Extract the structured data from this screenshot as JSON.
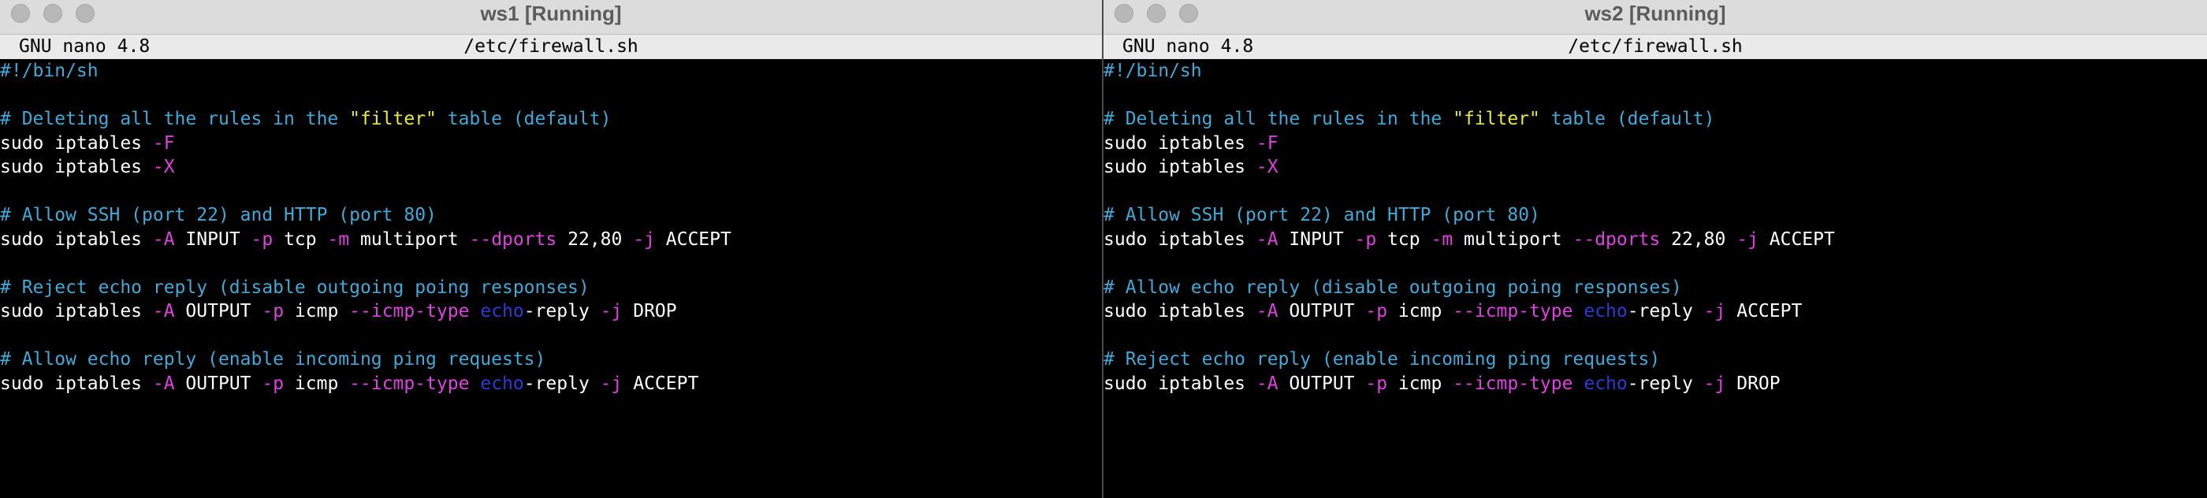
{
  "windows": [
    {
      "title": "ws1 [Running]",
      "nano_version": "GNU nano 4.8",
      "file_path": "/etc/firewall.sh",
      "lines": [
        [
          {
            "t": "#!/bin/sh",
            "c": "c"
          }
        ],
        [],
        [
          {
            "t": "# Deleting all the rules in the ",
            "c": "c"
          },
          {
            "t": "\"filter\"",
            "c": "s"
          },
          {
            "t": " table (default)",
            "c": "c"
          }
        ],
        [
          {
            "t": "sudo iptables ",
            "c": "t"
          },
          {
            "t": "-F",
            "c": "f"
          }
        ],
        [
          {
            "t": "sudo iptables ",
            "c": "t"
          },
          {
            "t": "-X",
            "c": "f"
          }
        ],
        [],
        [
          {
            "t": "# Allow SSH (port 22) and HTTP (port 80)",
            "c": "c"
          }
        ],
        [
          {
            "t": "sudo iptables ",
            "c": "t"
          },
          {
            "t": "-A",
            "c": "f"
          },
          {
            "t": " INPUT ",
            "c": "t"
          },
          {
            "t": "-p",
            "c": "f"
          },
          {
            "t": " tcp ",
            "c": "t"
          },
          {
            "t": "-m",
            "c": "f"
          },
          {
            "t": " multiport ",
            "c": "t"
          },
          {
            "t": "--dports",
            "c": "f"
          },
          {
            "t": " 22,80 ",
            "c": "t"
          },
          {
            "t": "-j",
            "c": "f"
          },
          {
            "t": " ACCEPT",
            "c": "t"
          }
        ],
        [],
        [
          {
            "t": "# Reject echo reply (disable outgoing poing responses)",
            "c": "c"
          }
        ],
        [
          {
            "t": "sudo iptables ",
            "c": "t"
          },
          {
            "t": "-A",
            "c": "f"
          },
          {
            "t": " OUTPUT ",
            "c": "t"
          },
          {
            "t": "-p",
            "c": "f"
          },
          {
            "t": " icmp ",
            "c": "t"
          },
          {
            "t": "--icmp-type",
            "c": "f"
          },
          {
            "t": " ",
            "c": "t"
          },
          {
            "t": "echo",
            "c": "k"
          },
          {
            "t": "-reply ",
            "c": "t"
          },
          {
            "t": "-j",
            "c": "f"
          },
          {
            "t": " DROP",
            "c": "t"
          }
        ],
        [],
        [
          {
            "t": "# Allow echo reply (enable incoming ping requests)",
            "c": "c"
          }
        ],
        [
          {
            "t": "sudo iptables ",
            "c": "t"
          },
          {
            "t": "-A",
            "c": "f"
          },
          {
            "t": " OUTPUT ",
            "c": "t"
          },
          {
            "t": "-p",
            "c": "f"
          },
          {
            "t": " icmp ",
            "c": "t"
          },
          {
            "t": "--icmp-type",
            "c": "f"
          },
          {
            "t": " ",
            "c": "t"
          },
          {
            "t": "echo",
            "c": "k"
          },
          {
            "t": "-reply ",
            "c": "t"
          },
          {
            "t": "-j",
            "c": "f"
          },
          {
            "t": " ACCEPT",
            "c": "t"
          }
        ]
      ]
    },
    {
      "title": "ws2 [Running]",
      "nano_version": "GNU nano 4.8",
      "file_path": "/etc/firewall.sh",
      "lines": [
        [
          {
            "t": "#!/bin/sh",
            "c": "c"
          }
        ],
        [],
        [
          {
            "t": "# Deleting all the rules in the ",
            "c": "c"
          },
          {
            "t": "\"filter\"",
            "c": "s"
          },
          {
            "t": " table (default)",
            "c": "c"
          }
        ],
        [
          {
            "t": "sudo iptables ",
            "c": "t"
          },
          {
            "t": "-F",
            "c": "f"
          }
        ],
        [
          {
            "t": "sudo iptables ",
            "c": "t"
          },
          {
            "t": "-X",
            "c": "f"
          }
        ],
        [],
        [
          {
            "t": "# Allow SSH (port 22) and HTTP (port 80)",
            "c": "c"
          }
        ],
        [
          {
            "t": "sudo iptables ",
            "c": "t"
          },
          {
            "t": "-A",
            "c": "f"
          },
          {
            "t": " INPUT ",
            "c": "t"
          },
          {
            "t": "-p",
            "c": "f"
          },
          {
            "t": " tcp ",
            "c": "t"
          },
          {
            "t": "-m",
            "c": "f"
          },
          {
            "t": " multiport ",
            "c": "t"
          },
          {
            "t": "--dports",
            "c": "f"
          },
          {
            "t": " 22,80 ",
            "c": "t"
          },
          {
            "t": "-j",
            "c": "f"
          },
          {
            "t": " ACCEPT",
            "c": "t"
          }
        ],
        [],
        [
          {
            "t": "# Allow echo reply (disable outgoing poing responses)",
            "c": "c"
          }
        ],
        [
          {
            "t": "sudo iptables ",
            "c": "t"
          },
          {
            "t": "-A",
            "c": "f"
          },
          {
            "t": " OUTPUT ",
            "c": "t"
          },
          {
            "t": "-p",
            "c": "f"
          },
          {
            "t": " icmp ",
            "c": "t"
          },
          {
            "t": "--icmp-type",
            "c": "f"
          },
          {
            "t": " ",
            "c": "t"
          },
          {
            "t": "echo",
            "c": "k"
          },
          {
            "t": "-reply ",
            "c": "t"
          },
          {
            "t": "-j",
            "c": "f"
          },
          {
            "t": " ACCEPT",
            "c": "t"
          }
        ],
        [],
        [
          {
            "t": "# Reject echo reply (enable incoming ping requests)",
            "c": "c"
          }
        ],
        [
          {
            "t": "sudo iptables ",
            "c": "t"
          },
          {
            "t": "-A",
            "c": "f"
          },
          {
            "t": " OUTPUT ",
            "c": "t"
          },
          {
            "t": "-p",
            "c": "f"
          },
          {
            "t": " icmp ",
            "c": "t"
          },
          {
            "t": "--icmp-type",
            "c": "f"
          },
          {
            "t": " ",
            "c": "t"
          },
          {
            "t": "echo",
            "c": "k"
          },
          {
            "t": "-reply ",
            "c": "t"
          },
          {
            "t": "-j",
            "c": "f"
          },
          {
            "t": " DROP",
            "c": "t"
          }
        ]
      ]
    }
  ],
  "syntax_colors": {
    "comment": "#3fa9d8",
    "string": "#e8e840",
    "flag": "#e040e0",
    "keyword": "#2a3bd6",
    "text": "#ffffff"
  },
  "traffic_lights": [
    "close-button",
    "minimize-button",
    "zoom-button"
  ]
}
